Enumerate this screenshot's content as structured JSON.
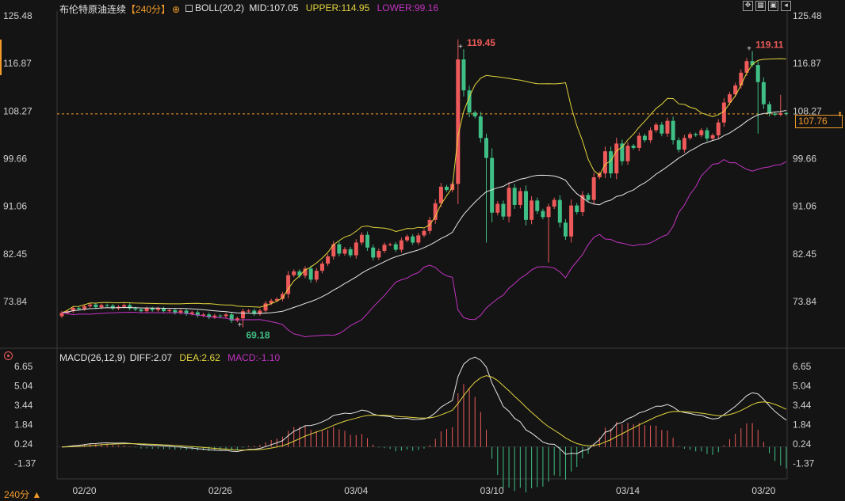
{
  "header": {
    "instrument": "布伦特原油连续",
    "period": "【240分】",
    "boll_label": "BOLL(20,2)",
    "mid": "MID:107.05",
    "upper": "UPPER:114.95",
    "lower": "LOWER:99.16",
    "macd_label": "MACD(26,12,9)",
    "diff": "DIFF:2.07",
    "dea": "DEA:2.62",
    "macd": "MACD:-1.10",
    "period_selector": "240分 ▲",
    "current_price": "107.76"
  },
  "colors": {
    "up": "#ee5a5a",
    "down": "#3fbf85",
    "mid_line": "#e6e6e6",
    "upper_line": "#e2d33d",
    "lower_line": "#c233c2",
    "diff_line": "#e6e6e6",
    "dea_line": "#e2d33d",
    "price_line": "#f29b2b",
    "max_label": "#ee5a5a",
    "min_label": "#3fbf85"
  },
  "chart_data": [
    {
      "type": "candlestick",
      "indicator": "BOLL(20,2)",
      "y_ticks": [
        "125.48",
        "116.87",
        "108.27",
        "99.66",
        "91.06",
        "82.45",
        "73.84"
      ],
      "ylim": [
        66.0,
        125.48
      ],
      "x_ticks": [
        "02/20",
        "02/26",
        "03/04",
        "03/10",
        "03/14",
        "03/20"
      ],
      "x_tick_index": [
        4,
        28,
        52,
        76,
        100,
        124
      ],
      "current_price": 107.76,
      "annotations": [
        {
          "text": "119.45",
          "index": 71,
          "value": 119.45,
          "kind": "max"
        },
        {
          "text": "119.11",
          "index": 122,
          "value": 119.11,
          "kind": "max"
        },
        {
          "text": "69.18",
          "index": 32,
          "value": 69.18,
          "kind": "min"
        }
      ],
      "close": [
        71.8,
        72.1,
        72.7,
        72.5,
        73.0,
        73.3,
        72.8,
        73.2,
        73.1,
        72.6,
        72.9,
        73.2,
        72.6,
        72.4,
        72.1,
        72.6,
        72.3,
        72.6,
        72.1,
        72.3,
        71.8,
        72.2,
        71.6,
        71.9,
        71.3,
        71.5,
        71.0,
        71.3,
        71.2,
        71.5,
        70.4,
        70.8,
        72.1,
        72.2,
        71.6,
        72.2,
        73.5,
        74.0,
        74.3,
        75.2,
        78.6,
        79.3,
        78.5,
        79.8,
        77.8,
        79.4,
        80.7,
        82.0,
        84.2,
        82.5,
        83.3,
        82.2,
        84.5,
        85.9,
        83.6,
        81.8,
        83.0,
        84.1,
        84.2,
        83.2,
        84.9,
        85.6,
        84.5,
        85.8,
        86.6,
        88.6,
        91.6,
        94.6,
        94.0,
        95.1,
        117.6,
        112.0,
        108.0,
        107.3,
        103.4,
        99.8,
        89.9,
        91.5,
        89.2,
        94.4,
        91.3,
        93.8,
        88.6,
        92.1,
        90.2,
        89.1,
        91.0,
        92.2,
        88.1,
        85.6,
        91.2,
        90.0,
        93.1,
        92.2,
        96.3,
        97.0,
        101.0,
        97.0,
        102.4,
        99.2,
        102.0,
        101.6,
        103.8,
        103.0,
        104.8,
        105.8,
        104.2,
        106.5,
        103.0,
        101.3,
        103.4,
        104.1,
        103.9,
        104.8,
        103.3,
        103.9,
        106.2,
        109.8,
        111.3,
        112.9,
        115.2,
        117.3,
        116.6,
        113.5,
        109.5,
        107.8,
        107.6,
        107.9,
        107.76
      ],
      "volume_indicator": "MACD(26,12,9)"
    },
    {
      "type": "line",
      "indicator": "MACD(26,12,9)",
      "y_ticks": [
        "6.65",
        "5.04",
        "3.44",
        "1.84",
        "0.24",
        "-1.37"
      ],
      "ylim": [
        -2.8,
        6.65
      ],
      "series_names": [
        "DIFF",
        "DEA",
        "MACD"
      ],
      "last_values": {
        "DIFF": 2.07,
        "DEA": 2.62,
        "MACD": -1.1
      }
    }
  ]
}
